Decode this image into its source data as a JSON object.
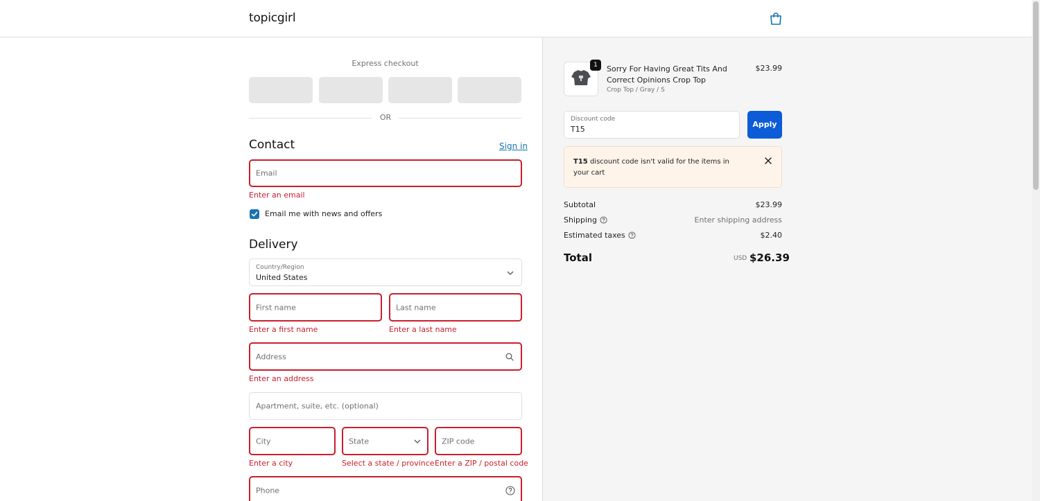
{
  "header": {
    "brand": "topicgirl",
    "cart_icon": "shopping-bag-icon"
  },
  "express": {
    "title": "Express checkout",
    "or": "OR"
  },
  "contact": {
    "title": "Contact",
    "sign_in": "Sign in",
    "email_placeholder": "Email",
    "email_error": "Enter an email",
    "newsletter_label": "Email me with news and offers",
    "newsletter_checked": true
  },
  "delivery": {
    "title": "Delivery",
    "country_label": "Country/Region",
    "country_value": "United States",
    "first_name_placeholder": "First name",
    "first_name_error": "Enter a first name",
    "last_name_placeholder": "Last name",
    "last_name_error": "Enter a last name",
    "address_placeholder": "Address",
    "address_error": "Enter an address",
    "apartment_placeholder": "Apartment, suite, etc. (optional)",
    "city_placeholder": "City",
    "city_error": "Enter a city",
    "state_placeholder": "State",
    "state_error": "Select a state / province",
    "zip_placeholder": "ZIP code",
    "zip_error": "Enter a ZIP / postal code",
    "phone_placeholder": "Phone"
  },
  "order": {
    "item": {
      "quantity": "1",
      "name": "Sorry For Having Great Tits And Correct Opinions Crop Top",
      "variant": "Crop Top / Gray / S",
      "price": "$23.99"
    },
    "discount_label": "Discount code",
    "discount_value": "T15",
    "apply_label": "Apply",
    "banner_code": "T15",
    "banner_message": "discount code isn't valid for the items in your cart",
    "subtotal_label": "Subtotal",
    "subtotal_value": "$23.99",
    "shipping_label": "Shipping",
    "shipping_value": "Enter shipping address",
    "taxes_label": "Estimated taxes",
    "taxes_value": "$2.40",
    "total_label": "Total",
    "currency": "USD",
    "total_value": "$26.39"
  },
  "colors": {
    "accent": "#1773b0",
    "apply_button": "#0b5cd6",
    "error": "#c81e2c",
    "banner_bg": "#fff4ea"
  }
}
